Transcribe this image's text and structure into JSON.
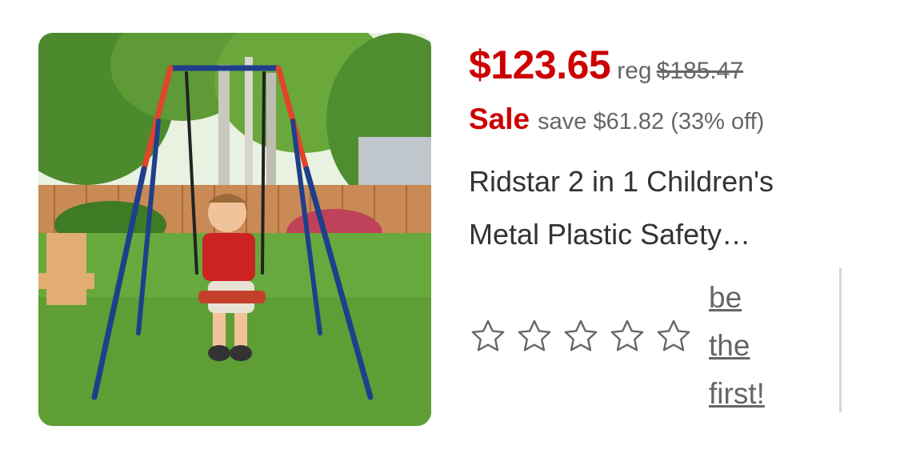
{
  "product": {
    "price": "$123.65",
    "reg_label": "reg",
    "reg_price": "$185.47",
    "sale_label": "Sale",
    "savings": "save $61.82 (33% off)",
    "title_line1": "Ridstar 2 in 1 Children's",
    "title_line2": "Metal Plastic Safety…",
    "rating": {
      "stars": [
        "star-outline-icon",
        "star-outline-icon",
        "star-outline-icon",
        "star-outline-icon",
        "star-outline-icon"
      ],
      "review_link_line1": "be",
      "review_link_line2": "the",
      "review_link_line3": "first!"
    }
  },
  "colors": {
    "price_red": "#cc0000",
    "muted_gray": "#666666",
    "title_text": "#333333"
  }
}
